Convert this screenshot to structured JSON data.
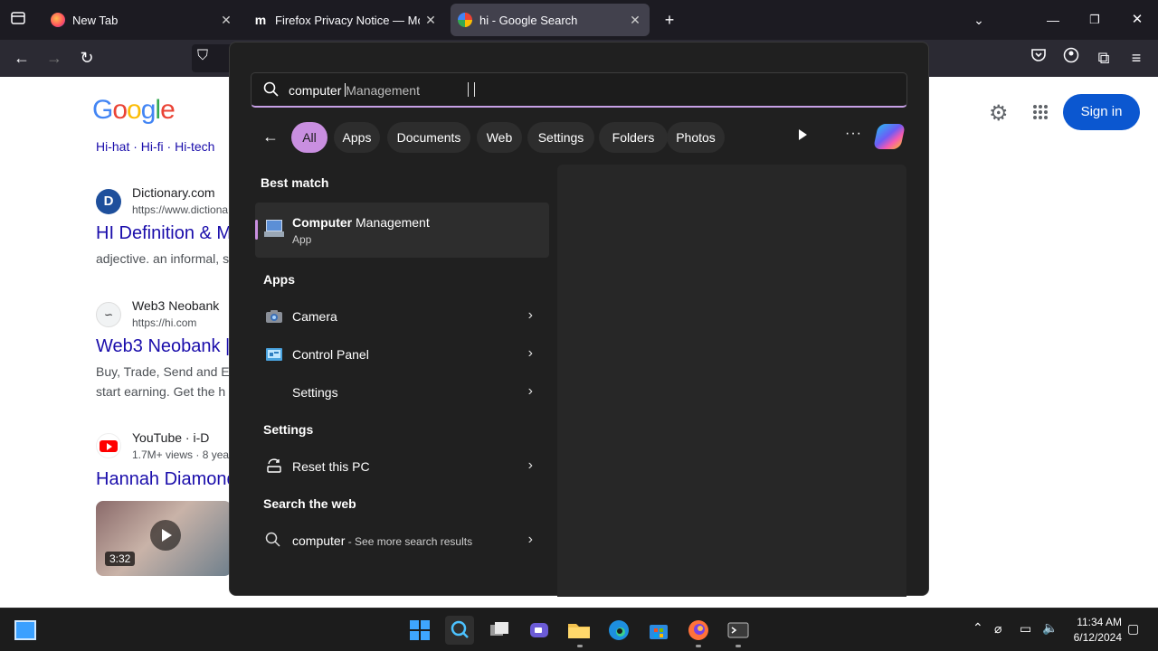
{
  "tabs": [
    {
      "title": "New Tab"
    },
    {
      "title": "Firefox Privacy Notice — Mozil"
    },
    {
      "title": "hi - Google Search"
    }
  ],
  "google": {
    "logo": "Google",
    "sign_in": "Sign in",
    "related": "Hi-hat · Hi-fi · Hi-tech",
    "results": [
      {
        "site": "Dictionary.com",
        "url": "https://www.dictiona",
        "title": "HI Definition & M",
        "snippet": "adjective. an informal, s"
      },
      {
        "site": "Web3 Neobank",
        "url": "https://hi.com",
        "title": "Web3 Neobank |",
        "snippet": "Buy, Trade, Send and E",
        "snippet2": "start earning. Get the h"
      },
      {
        "site": "YouTube · i-D",
        "url": "1.7M+ views · 8 yea",
        "title": "Hannah Diamond",
        "duration": "3:32"
      }
    ]
  },
  "search": {
    "typed": "computer ",
    "suggest": "Management"
  },
  "filters": [
    "All",
    "Apps",
    "Documents",
    "Web",
    "Settings",
    "Folders",
    "Photos"
  ],
  "best_match": {
    "heading": "Best match",
    "name_bold": "Computer",
    "name_rest": " Management",
    "type": "App"
  },
  "apps": {
    "heading": "Apps",
    "items": [
      "Camera",
      "Control Panel",
      "Settings"
    ]
  },
  "settings": {
    "heading": "Settings",
    "items": [
      "Reset this PC"
    ]
  },
  "web": {
    "heading": "Search the web",
    "query": "computer",
    "suffix": " - See more search results"
  },
  "clock": {
    "time": "11:34 AM",
    "date": "6/12/2024"
  },
  "colors": {
    "accent": "#c98fe0",
    "link": "#1a0dab",
    "signin": "#0b57d0"
  }
}
